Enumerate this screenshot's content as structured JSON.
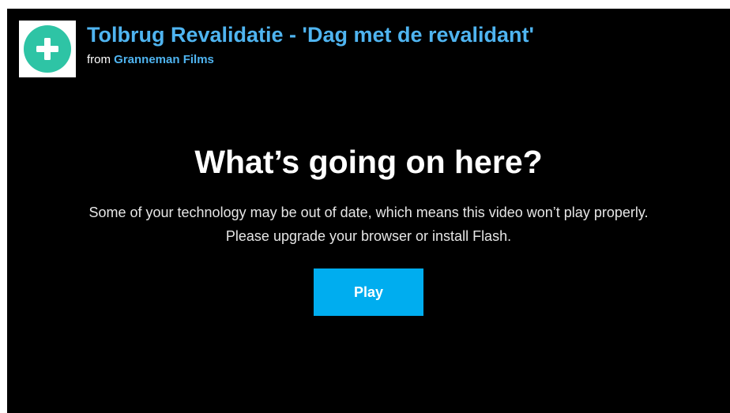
{
  "colors": {
    "accent": "#00adef",
    "title": "#4fb4f0",
    "background": "#000000",
    "portrait_icon": "#2ec4a5"
  },
  "header": {
    "portrait_icon": "plus-circle-icon",
    "title": "Tolbrug Revalidatie - 'Dag met de revalidant'",
    "byline_prefix": "from",
    "byline_author": "Granneman Films"
  },
  "message": {
    "heading": "What’s going on here?",
    "body": "Some of your technology may be out of date, which means this video won’t play properly. Please upgrade your browser or install Flash.",
    "play_label": "Play"
  }
}
